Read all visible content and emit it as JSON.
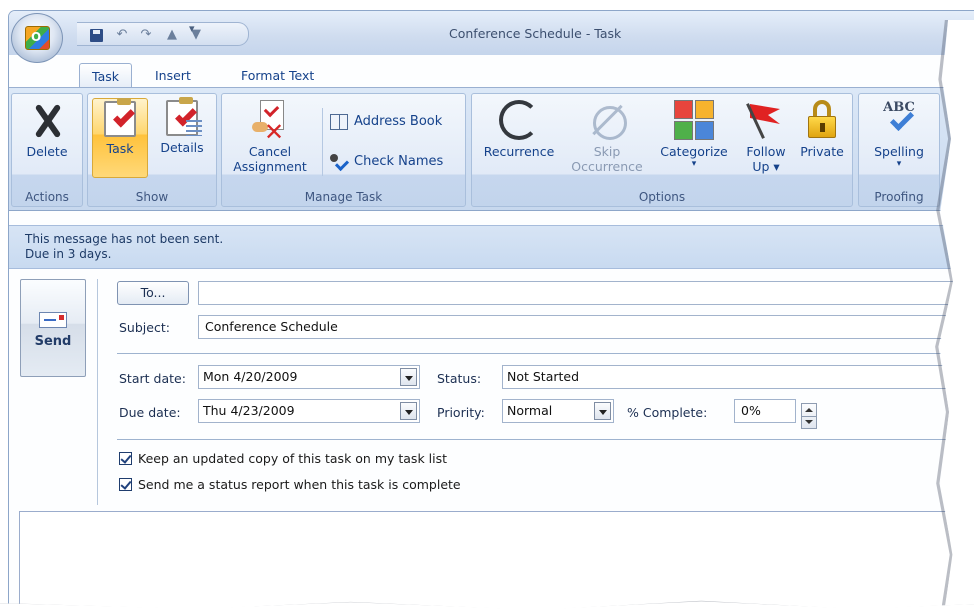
{
  "window": {
    "title": "Conference Schedule - Task"
  },
  "quick_access": {
    "customize_glyph": "▾"
  },
  "tabs": [
    {
      "label": "Task",
      "active": true
    },
    {
      "label": "Insert",
      "active": false
    },
    {
      "label": "Format Text",
      "active": false
    }
  ],
  "ribbon": {
    "actions": {
      "label": "Actions",
      "delete": "Delete"
    },
    "show": {
      "label": "Show",
      "task": "Task",
      "details": "Details"
    },
    "manage": {
      "label": "Manage Task",
      "cancel_line1": "Cancel",
      "cancel_line2": "Assignment",
      "address_book": "Address Book",
      "check_names": "Check Names"
    },
    "options": {
      "label": "Options",
      "recurrence": "Recurrence",
      "skip_line1": "Skip",
      "skip_line2": "Occurrence",
      "categorize": "Categorize",
      "follow_line1": "Follow",
      "follow_line2": "Up",
      "private": "Private"
    },
    "proofing": {
      "label": "Proofing",
      "spelling": "Spelling"
    },
    "dropdown_glyph": "▾"
  },
  "infobar": {
    "line1": "This message has not been sent.",
    "line2": "Due in 3 days."
  },
  "form": {
    "send": "Send",
    "to_button": "To...",
    "to_value": "",
    "subject_label": "Subject:",
    "subject_value": "Conference Schedule",
    "start_label": "Start date:",
    "start_value": "Mon 4/20/2009",
    "due_label": "Due date:",
    "due_value": "Thu 4/23/2009",
    "status_label": "Status:",
    "status_value": "Not Started",
    "priority_label": "Priority:",
    "priority_value": "Normal",
    "complete_label": "% Complete:",
    "complete_value": "0%",
    "keep_copy": "Keep an updated copy of this task on my task list",
    "status_report": "Send me a status report when this task is complete",
    "keep_copy_checked": true,
    "status_report_checked": true
  },
  "colors": {
    "accent": "#15428b",
    "ribbon_bg": "#c7d8ee",
    "selected_button": "#ffd66e"
  }
}
